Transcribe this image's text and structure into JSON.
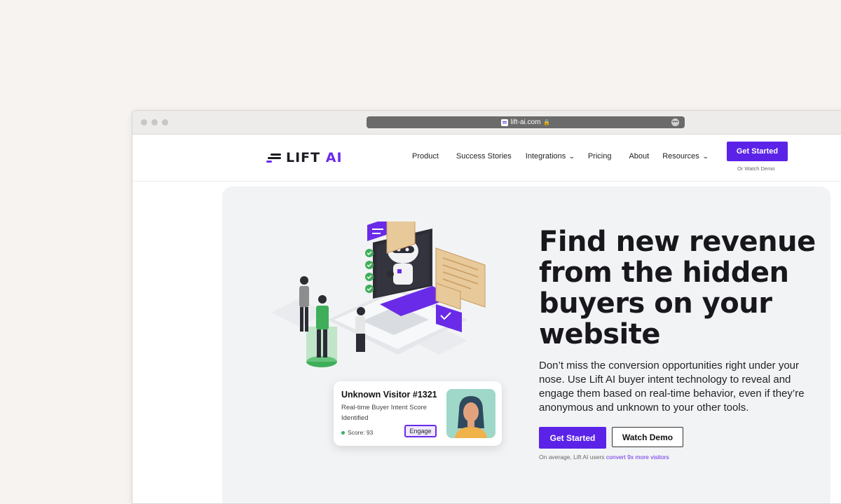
{
  "browser": {
    "url": "lift-ai.com",
    "lock_icon": "lock-icon",
    "more_icon": "ellipsis-icon"
  },
  "nav": {
    "logo_text": "LIFT",
    "logo_text_accent": "AI",
    "items": [
      {
        "label": "Product",
        "dropdown": false
      },
      {
        "label": "Success Stories",
        "dropdown": false
      },
      {
        "label": "Integrations",
        "dropdown": true
      },
      {
        "label": "Pricing",
        "dropdown": false
      },
      {
        "label": "About",
        "dropdown": false
      },
      {
        "label": "Resources",
        "dropdown": true
      }
    ],
    "cta_label": "Get Started",
    "cta_sublabel": "Or Watch Demo"
  },
  "hero": {
    "headline": "Find new revenue from the hidden buyers on your website",
    "subtext": "Don’t miss the conversion opportunities right under your nose. Use Lift AI buyer intent technology to reveal and engage them based on real-time behavior, even if they’re anonymous and unknown to your other tools.",
    "primary_cta": "Get Started",
    "secondary_cta": "Watch Demo",
    "note_prefix": "On average, Lift AI users ",
    "note_link": "convert 9x more visitors"
  },
  "visitor_card": {
    "title": "Unknown Visitor #1321",
    "subtitle": "Real-time Buyer Intent Score Identified",
    "score": "Score: 93",
    "action": "Engage"
  },
  "colors": {
    "brand": "#5b23e8",
    "accent_green": "#3fae5a",
    "background": "#f6f3f0"
  }
}
